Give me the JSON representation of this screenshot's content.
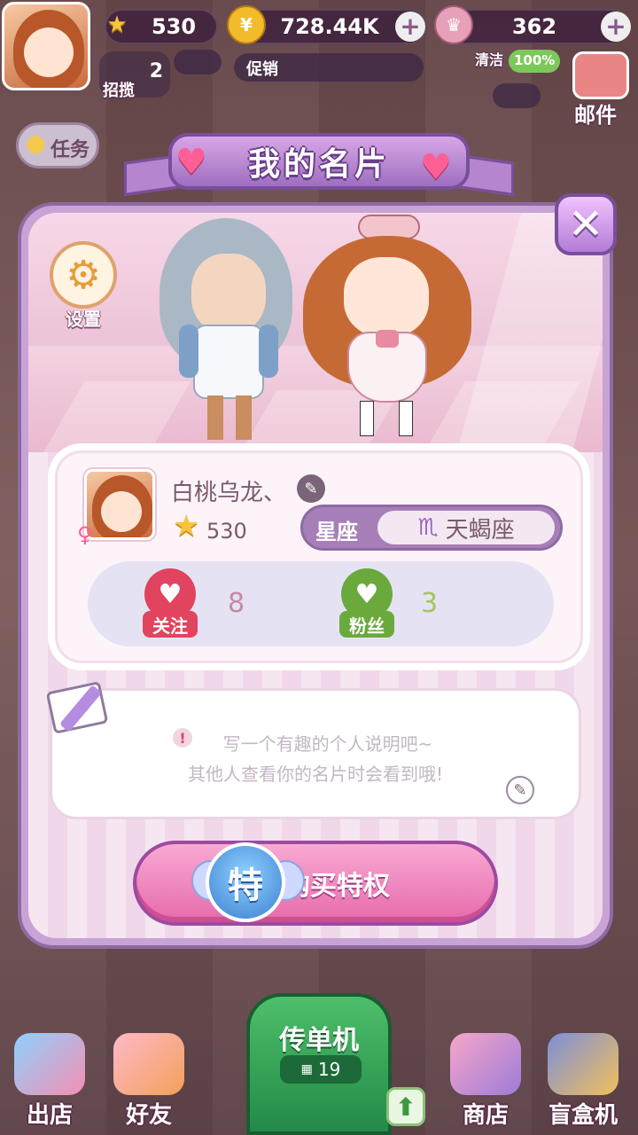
{
  "hud": {
    "stars": "530",
    "coins": "728.44K",
    "crowns": "362",
    "recruit_label": "招揽",
    "recruit_count": "2",
    "promo_label": "促销",
    "clean_label": "清洁",
    "clean_value": "100%",
    "mail_label": "邮件",
    "task_label": "任务"
  },
  "modal": {
    "title": "我的名片",
    "settings_label": "设置",
    "profile": {
      "name": "白桃乌龙、",
      "stars": "530",
      "zodiac_label": "星座",
      "zodiac_symbol": "♏",
      "zodiac_value": "天蝎座",
      "follow_label": "关注",
      "follow_count": "8",
      "fans_label": "粉丝",
      "fans_count": "3"
    },
    "bio": {
      "line1": "写一个有趣的个人说明吧~",
      "line2": "其他人查看你的名片时会看到哦!"
    },
    "buy_badge": "特",
    "buy_label": "购买特权"
  },
  "nav": {
    "exit_label": "出店",
    "friends_label": "好友",
    "flyer_label": "传单机",
    "flyer_count": "19",
    "shop_label": "商店",
    "blindbox_label": "盲盒机"
  },
  "colors": {
    "modal_border": "#8e6aa3",
    "buy_button": "#e66aaa",
    "follow_red": "#e0445e",
    "fans_green": "#6aaa3c"
  }
}
